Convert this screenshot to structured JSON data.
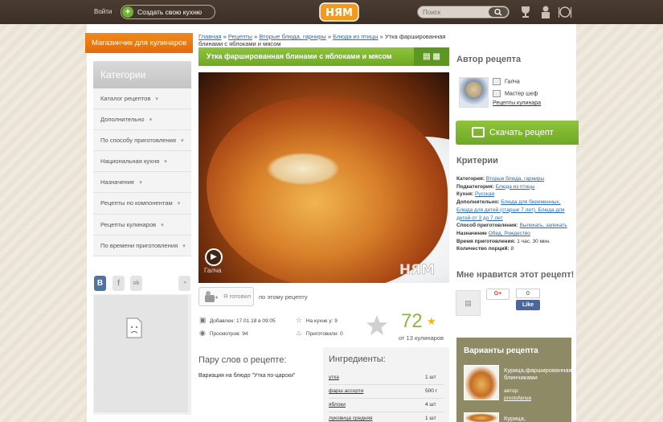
{
  "header": {
    "login_label": "Войти",
    "create_label": "Создать свою кухню",
    "logo_text": "НЯМ",
    "search_placeholder": "Поиск"
  },
  "left": {
    "shop_label": "Магазинчик для кулинаров",
    "categories_title": "Категории",
    "categories": [
      "Каталог рецептов",
      "Дополнительно",
      "По способу приготовления",
      "Национальная кухня",
      "Назначение",
      "Рецепты по компонентам",
      "Рецепты кулинаров",
      "По времени приготовления"
    ],
    "social": [
      "В",
      "f",
      "ok"
    ]
  },
  "breadcrumb": {
    "items": [
      "Главная",
      "Рецепты",
      "Вторые блюда, гарниры",
      "Блюда из птицы"
    ],
    "current": "Утка фаршированная блинами с яблоками и мясом",
    "separator": "»"
  },
  "recipe": {
    "title": "Утка фаршированная блинами с яблоками и мясом",
    "photo_author": "Галча",
    "photo_watermark": "НЯМ",
    "cooked_label": "Я готовил",
    "cooked_note": "по этому рецепту",
    "added_label": "Добавлен:",
    "added_value": "17.01.18 в 09:05",
    "views_label": "Просмотров:",
    "views_value": "94",
    "in_kitchen_label": "На кухне у:",
    "in_kitchen_value": "9",
    "cooked_count_label": "Приготовили:",
    "cooked_count_value": "0",
    "rating": "72",
    "rating_of": "от 13 кулинаров",
    "words_title": "Пару слов о рецепте:",
    "words_text": "Вариация на блюдо \"Утка по-царски\"",
    "ingredients_title": "Ингредиенты:",
    "ingredients": [
      {
        "name": "утка",
        "qty": "1 шт"
      },
      {
        "name": "фарш ассорти",
        "qty": "500 г"
      },
      {
        "name": "яблоки",
        "qty": "4 шт"
      },
      {
        "name": "луковица средняя",
        "qty": "1 шт"
      }
    ]
  },
  "author": {
    "section_title": "Автор рецепта",
    "name": "Галча",
    "rank": "Мастер шеф",
    "recipes_link": "Рецепты кулинара"
  },
  "download_label": "Скачать рецепт",
  "criteria": {
    "title": "Критерии",
    "rows": [
      {
        "label": "Категория:",
        "value": "Вторые блюда, гарниры"
      },
      {
        "label": "Подкатегория:",
        "value": "Блюда из птицы"
      },
      {
        "label": "Кухня:",
        "value": "Русская"
      },
      {
        "label": "Дополнительно:",
        "value": "Блюда для беременных, Блюда для детей (старше 7 лет), Блюда для детей от 3 до 7 лет"
      },
      {
        "label": "Способ приготовления:",
        "value": "Выпекать, запекать"
      },
      {
        "label": "Назначение",
        "value": "Обед, Рождество"
      },
      {
        "label": "Время приготовления:",
        "value": "1 час. 30 мин."
      },
      {
        "label": "Количество порций:",
        "value": "8"
      }
    ]
  },
  "like": {
    "title": "Мне нравится этот рецепт!",
    "gplus_label": "G+",
    "fb_count": "0",
    "fb_like_label": "Like"
  },
  "variants": {
    "title": "Варианты рецепта",
    "items": [
      {
        "title": "Курица,фаршированная блинчиками",
        "author_label": "автор:",
        "author": "prostofanya"
      },
      {
        "title": "Курица,",
        "author_label": "",
        "author": ""
      }
    ]
  },
  "colors": {
    "topbar": "#3b2f26",
    "green": "#7ab22e",
    "orange": "#e8750f",
    "variants_bg": "#8f8a66"
  }
}
